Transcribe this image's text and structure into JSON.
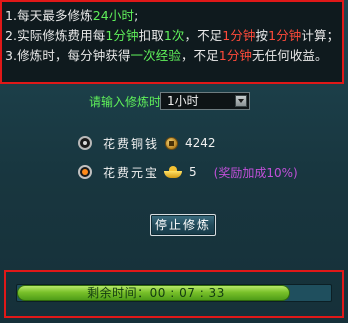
{
  "info": {
    "line1": {
      "n": "1.",
      "a": "每天最多修炼",
      "b": "24小时",
      "c": ";"
    },
    "line2": {
      "n": "2.",
      "a": "实际修炼费用每",
      "b": "1分钟",
      "c": "扣取",
      "d": "1次",
      "e": "，不足",
      "f": "1分钟",
      "g": "按",
      "h": "1分钟",
      "i": "计算；"
    },
    "line3": {
      "n": "3.",
      "a": "修炼时，每分钟获得",
      "b": "一次经验",
      "c": "，不足",
      "d": "1分钟",
      "e": "无任何收益。"
    }
  },
  "time_select": {
    "label": "请输入修炼时间：",
    "value": "1小时"
  },
  "options": {
    "copper": {
      "label": "花费铜钱",
      "value": "4242",
      "selected": false
    },
    "yuanbao": {
      "label": "花费元宝",
      "value": "5",
      "bonus": "(奖励加成10%)",
      "selected": true
    }
  },
  "stop_button": {
    "label": "停止修炼"
  },
  "progress": {
    "label": "剩余时间：00 : 07 : 33",
    "fraction": 0.87
  },
  "colors": {
    "green": "#5ff05a",
    "red": "#ff4a3a",
    "border_red": "#e01818",
    "bonus_purple": "#c050d8"
  }
}
